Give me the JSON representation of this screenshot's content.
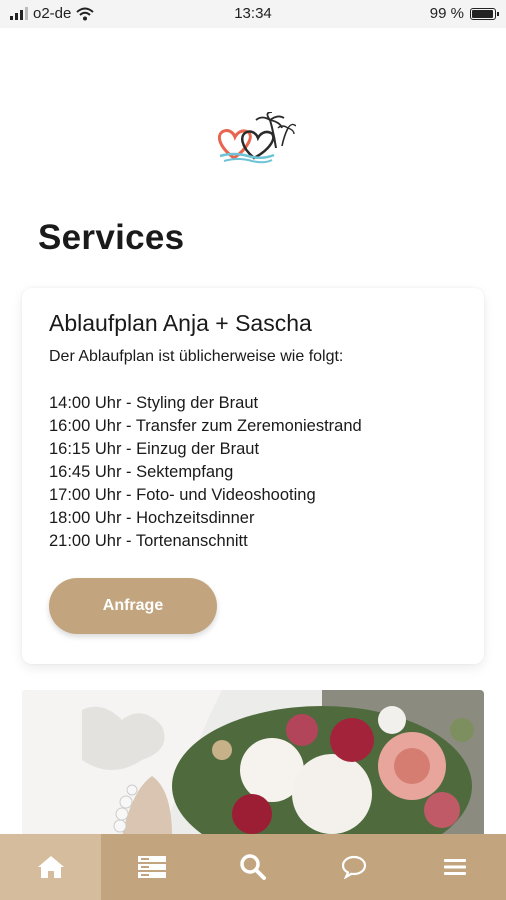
{
  "status_bar": {
    "carrier": "o2-de",
    "time": "13:34",
    "battery": "99 %",
    "battery_level": 0.99,
    "icons": [
      "signal-icon",
      "wifi-icon",
      "battery-icon"
    ]
  },
  "colors": {
    "accent": "#c2a57f",
    "tab_active": "#d4bc9c",
    "heart_coral": "#e8654f",
    "heart_dark": "#2a2a2a",
    "wave_blue": "#6ec3d6"
  },
  "page": {
    "title": "Services"
  },
  "card": {
    "title": "Ablaufplan Anja + Sascha",
    "intro": "Der Ablaufplan ist üblicherweise wie folgt:",
    "schedule": [
      "14:00 Uhr - Styling der Braut",
      "16:00 Uhr - Transfer zum Zeremoniestrand",
      "16:15 Uhr - Einzug der Braut",
      "16:45 Uhr - Sektempfang",
      "17:00 Uhr - Foto- und Videoshooting",
      "18:00 Uhr - Hochzeitsdinner",
      "21:00 Uhr - Tortenanschnitt"
    ],
    "button_label": "Anfrage"
  },
  "tabbar": {
    "active_index": 0,
    "items": [
      "home-icon",
      "services-icon",
      "search-icon",
      "chat-icon",
      "menu-icon"
    ]
  }
}
